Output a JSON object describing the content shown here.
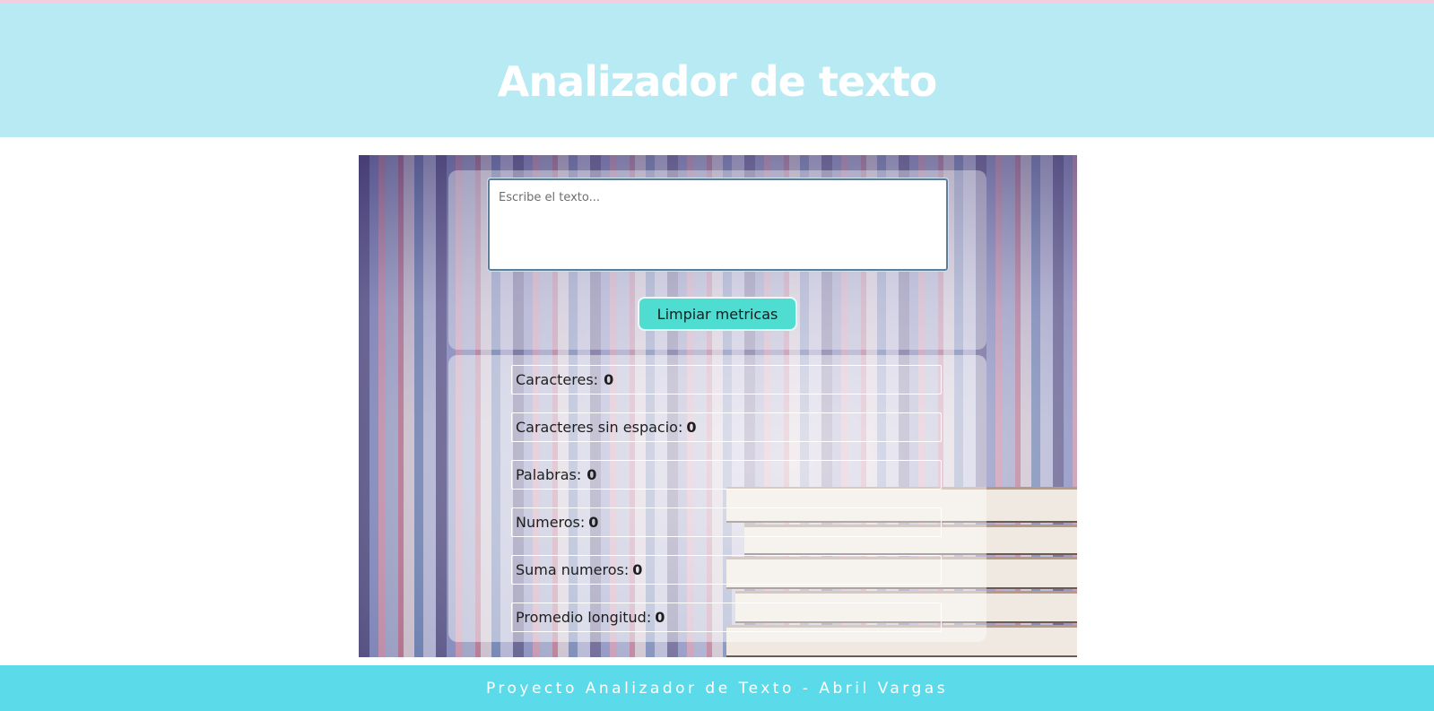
{
  "header": {
    "title": "Analizador de texto"
  },
  "input": {
    "placeholder": "Escribe el texto..."
  },
  "actions": {
    "clear_label": "Limpiar metricas"
  },
  "metrics": [
    {
      "label": "Caracteres:",
      "value": "0"
    },
    {
      "label": "Caracteres sin espacio:",
      "value": "0"
    },
    {
      "label": "Palabras:",
      "value": "0"
    },
    {
      "label": "Numeros:",
      "value": "0"
    },
    {
      "label": "Suma numeros:",
      "value": "0"
    },
    {
      "label": "Promedio longitud:",
      "value": "0"
    }
  ],
  "footer": {
    "text": "Proyecto Analizador de Texto - Abril Vargas"
  },
  "colors": {
    "header_bg": "#b7eaf2",
    "footer_bg": "#5bdbea",
    "button_bg": "#4fddd2"
  }
}
